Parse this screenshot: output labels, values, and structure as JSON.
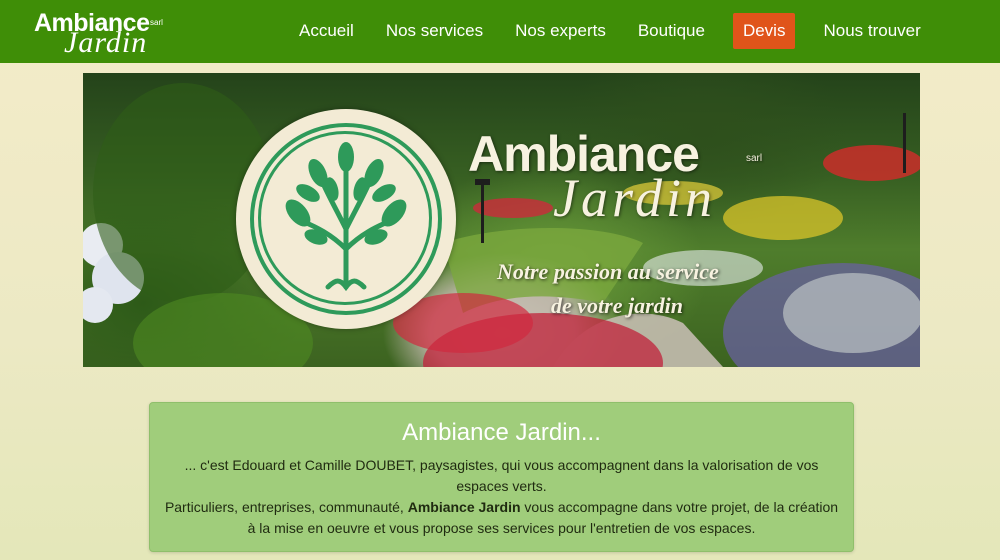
{
  "brand": {
    "logo_line1": "Ambiance",
    "logo_sarl": "sarl",
    "logo_line2": "Jardin",
    "primary_color": "#3f8e07",
    "accent_color": "#e0541a"
  },
  "nav": {
    "items": [
      {
        "label": "Accueil"
      },
      {
        "label": "Nos services"
      },
      {
        "label": "Nos experts"
      },
      {
        "label": "Boutique"
      },
      {
        "label": "Devis",
        "active": true
      },
      {
        "label": "Nous trouver"
      }
    ]
  },
  "hero": {
    "title_line1": "Ambiance",
    "title_sarl": "sarl",
    "title_line2": "Jardin",
    "tagline_line1": "Notre passion au service",
    "tagline_line2": "de votre jardin",
    "emblem_icon": "tree-icon"
  },
  "intro": {
    "heading": "Ambiance Jardin...",
    "line1": "... c'est Edouard et Camille DOUBET, paysagistes, qui vous accompagnent dans la valorisation de vos espaces verts.",
    "line2_pre": "Particuliers, entreprises, communauté,",
    "line2_bold": "Ambiance Jardin",
    "line2_post": "vous accompagne dans votre projet, de la création à la mise en oeuvre et vous propose ses services pour l'entretien de vos espaces."
  }
}
